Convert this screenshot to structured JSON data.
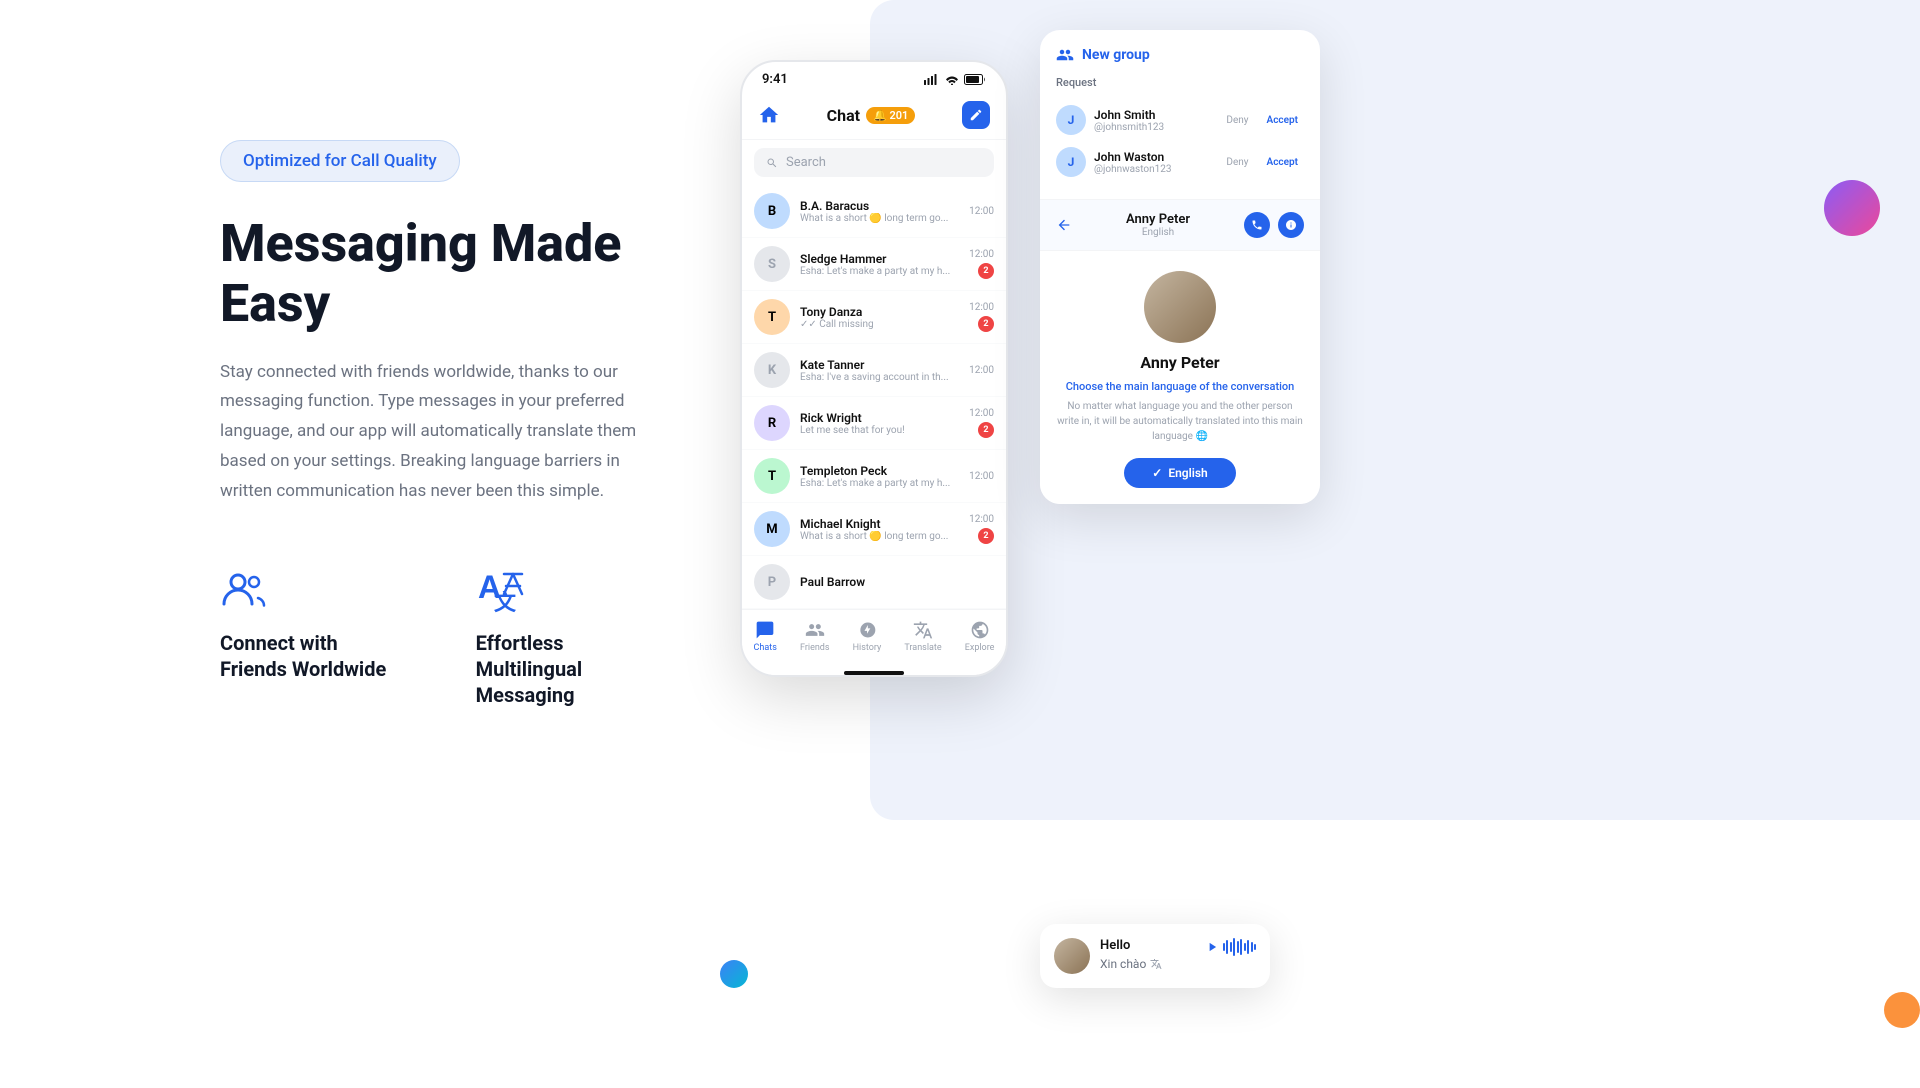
{
  "badge": {
    "label": "Optimized for Call Quality"
  },
  "hero": {
    "headline": "Messaging Made Easy",
    "description": "Stay connected with friends worldwide, thanks to our messaging function. Type messages in your preferred language, and our app will automatically translate them based on your settings. Breaking language barriers in written communication has never been this simple."
  },
  "features": [
    {
      "id": "connect",
      "title": "Connect with Friends Worldwide",
      "icon": "people-icon"
    },
    {
      "id": "multilingual",
      "title": "Effortless Multilingual Messaging",
      "icon": "translate-icon"
    }
  ],
  "phone": {
    "status_time": "9:41",
    "header_title": "Chat",
    "notification_count": "201",
    "search_placeholder": "Search",
    "chats": [
      {
        "name": "B.A. Baracus",
        "preview": "What is a short 🟡 long term go...",
        "time": "12:00",
        "unread": false,
        "initial": "B"
      },
      {
        "name": "Sledge Hammer",
        "preview": "Esha: Let's make a party at my h...",
        "time": "12:00",
        "unread": true,
        "initial": "S"
      },
      {
        "name": "Tony Danza",
        "preview": "✓✓ Call missing",
        "time": "12:00",
        "unread": true,
        "initial": "T"
      },
      {
        "name": "Kate Tanner",
        "preview": "Esha: I've a saving account in th...",
        "time": "12:00",
        "unread": false,
        "initial": "K"
      },
      {
        "name": "Rick Wright",
        "preview": "Let me see that for you!",
        "time": "12:00",
        "unread": true,
        "initial": "R"
      },
      {
        "name": "Templeton Peck",
        "preview": "Esha: Let's make a party at my h...",
        "time": "12:00",
        "unread": false,
        "initial": "T"
      },
      {
        "name": "Michael Knight",
        "preview": "What is a short 🟡 long term go...",
        "time": "12:00",
        "unread": true,
        "initial": "M"
      },
      {
        "name": "Paul Barrow",
        "preview": "",
        "time": "",
        "unread": false,
        "initial": "P"
      }
    ],
    "nav_items": [
      {
        "label": "Chats",
        "active": true
      },
      {
        "label": "Friends",
        "active": false
      },
      {
        "label": "History",
        "active": false
      },
      {
        "label": "Translate",
        "active": false
      },
      {
        "label": "Explore",
        "active": false
      }
    ]
  },
  "group_card": {
    "title": "New group",
    "request_label": "Request",
    "requests": [
      {
        "name": "John Smith",
        "handle": "@johnsmith123",
        "deny": "Deny",
        "accept": "Accept"
      },
      {
        "name": "John Waston",
        "handle": "@johnwaston123",
        "deny": "Deny",
        "accept": "Accept"
      }
    ]
  },
  "chat_detail": {
    "name": "Anny Peter",
    "language": "English",
    "lang_prompt": "Choose the main language of the conversation",
    "lang_desc": "No matter what language you and the other person write in, it will be automatically translated into this main language 🌐",
    "lang_button": "English"
  },
  "message_card": {
    "original": "Hello",
    "translation": "Xin chào"
  }
}
